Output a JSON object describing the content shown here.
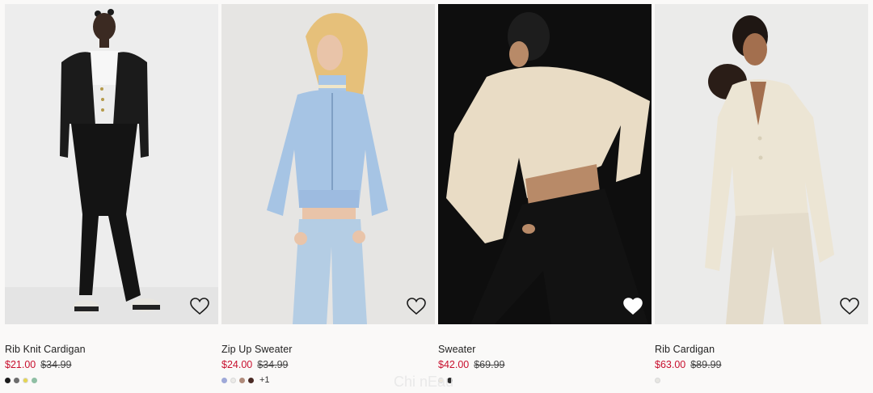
{
  "products": [
    {
      "title": "Rib Knit Cardigan",
      "price": "$21.00",
      "original_price": "$34.99",
      "image_bg": "#ececec",
      "favorite_filled": false,
      "swatches": [
        "#1c1c1c",
        "#6d6d6d",
        "#e5d54f",
        "#8fbfa4"
      ],
      "more_label": ""
    },
    {
      "title": "Zip Up Sweater",
      "price": "$24.00",
      "original_price": "$34.99",
      "image_bg": "#e5e4e2",
      "favorite_filled": false,
      "swatches": [
        "#9fa9d8",
        "#ecebe8",
        "#b08b7b",
        "#4a2a24"
      ],
      "more_label": "+1"
    },
    {
      "title": "Sweater",
      "price": "$42.00",
      "original_price": "$69.99",
      "image_bg": "#111111",
      "favorite_filled": true,
      "swatches": [
        "#ede6da",
        "#2a2a2a"
      ],
      "more_label": ""
    },
    {
      "title": "Rib Cardigan",
      "price": "$63.00",
      "original_price": "$89.99",
      "image_bg": "#ebebea",
      "favorite_filled": false,
      "swatches": [
        "#e7e6e2"
      ],
      "more_label": ""
    }
  ],
  "icons": {
    "favorite": "heart-icon"
  },
  "watermark": "Chi nEau"
}
